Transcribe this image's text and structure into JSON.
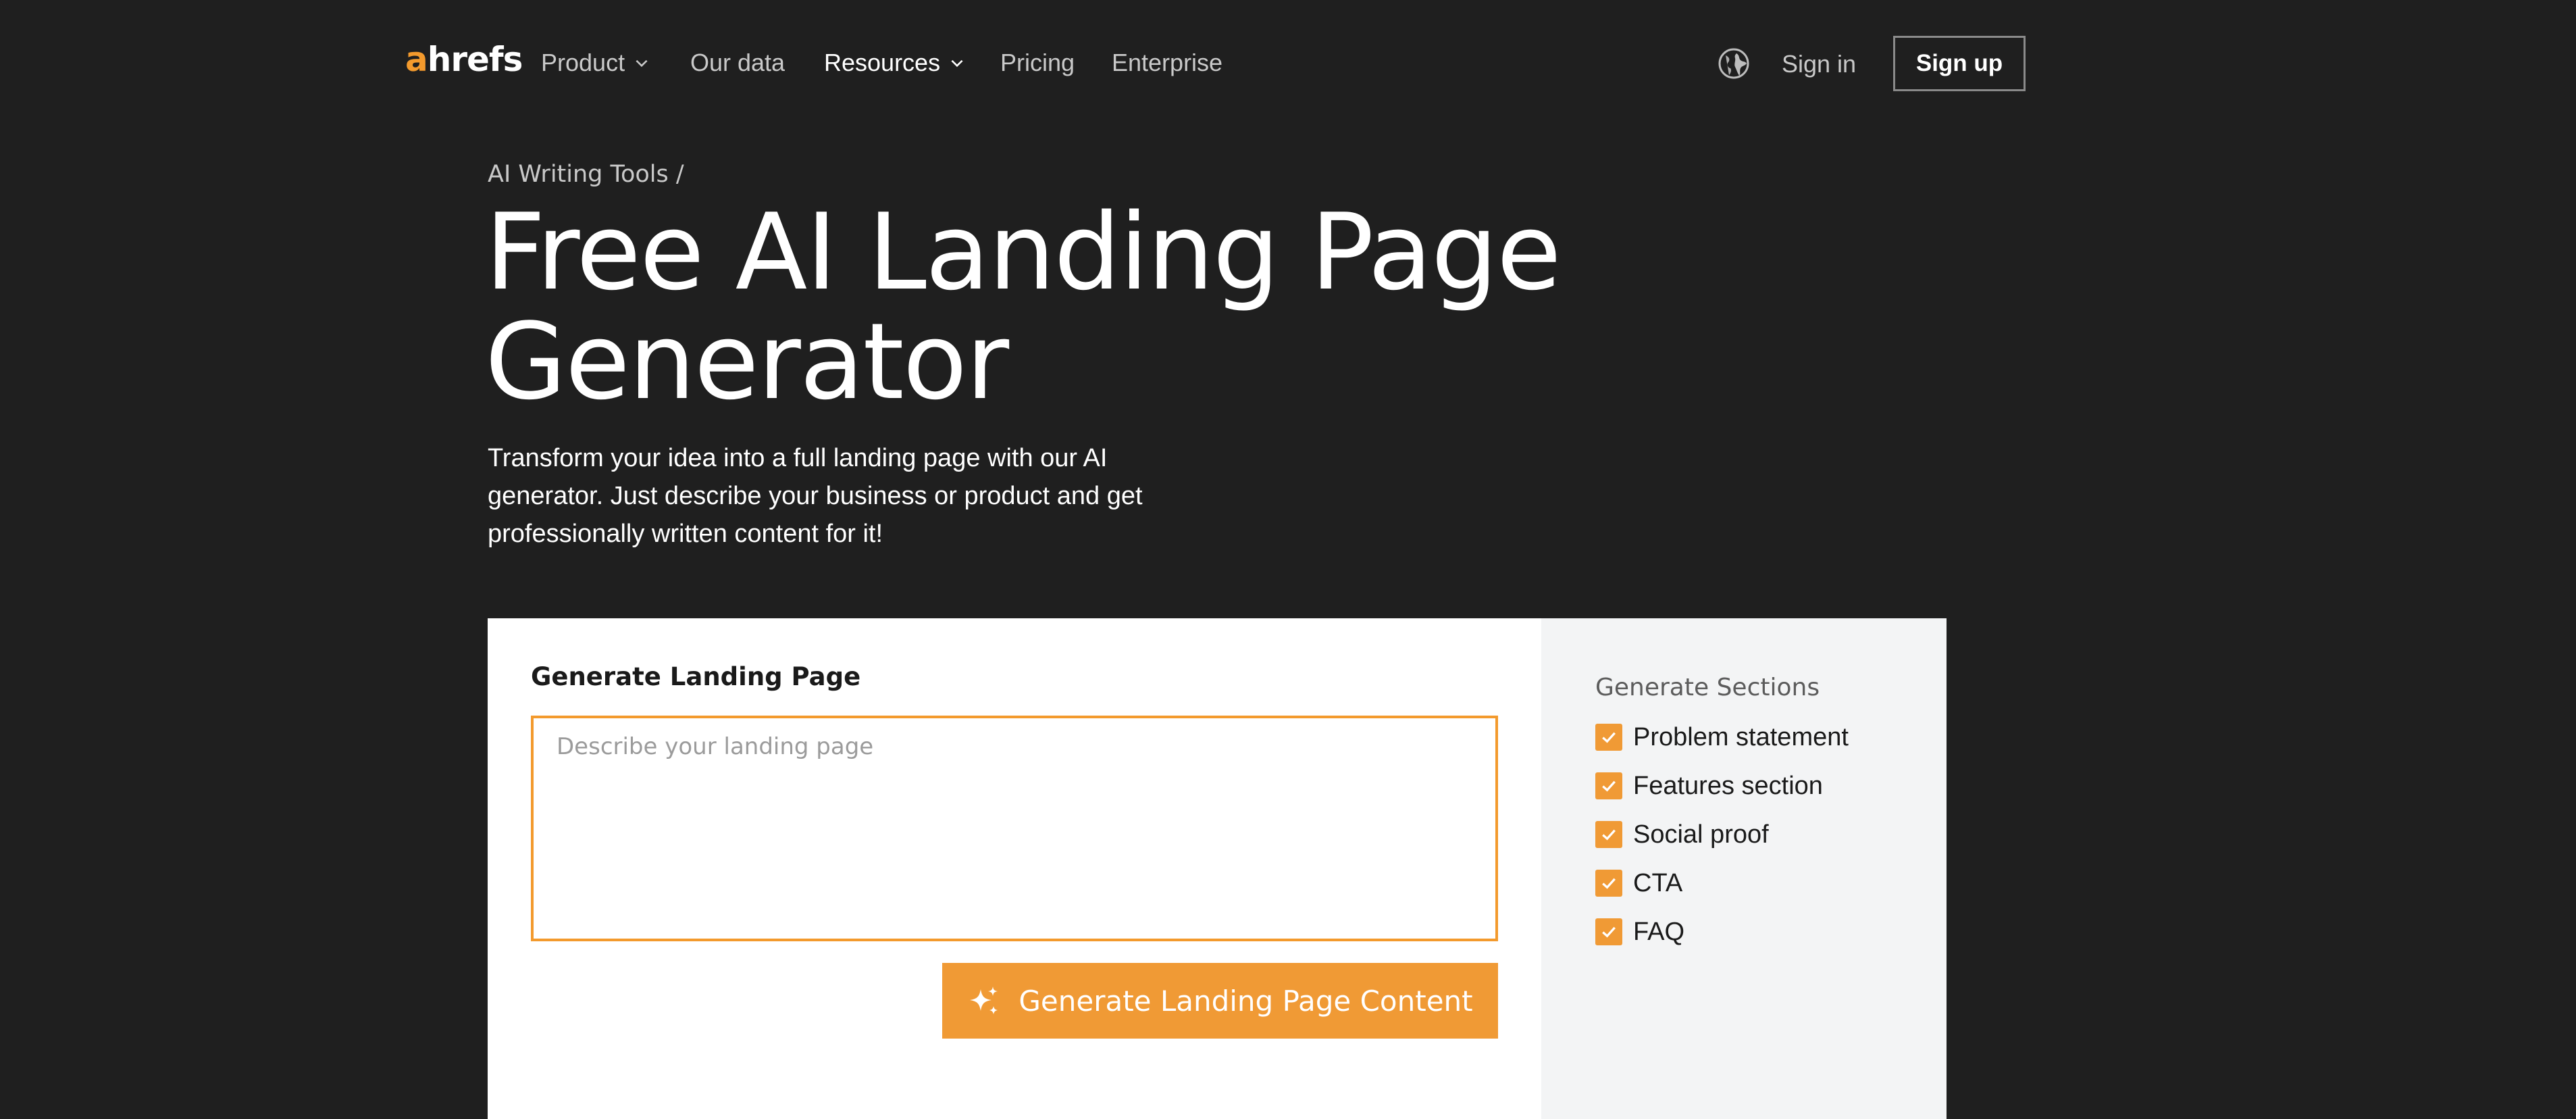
{
  "brand": {
    "logo_a": "a",
    "logo_rest": "hrefs",
    "accent": "#f39a2d"
  },
  "nav": {
    "items": [
      {
        "label": "Product",
        "dropdown": true
      },
      {
        "label": "Our data",
        "dropdown": false
      },
      {
        "label": "Resources",
        "dropdown": true
      },
      {
        "label": "Pricing",
        "dropdown": false
      },
      {
        "label": "Enterprise",
        "dropdown": false
      }
    ],
    "language_icon": "globe-icon",
    "sign_in": "Sign in",
    "sign_up": "Sign up"
  },
  "hero": {
    "breadcrumb": "AI Writing Tools /",
    "title_line1": "Free AI Landing Page",
    "title_line2": "Generator",
    "description": "Transform your idea into a full landing page with our AI generator. Just describe your business or product and get professionally written content for it!"
  },
  "form": {
    "label": "Generate Landing Page",
    "textarea_value": "",
    "placeholder": "Describe your landing page",
    "submit_label": "Generate Landing Page Content",
    "submit_icon": "sparkle-icon",
    "button_color": "#f09a35"
  },
  "sections": {
    "label": "Generate Sections",
    "options": [
      {
        "label": "Problem statement",
        "checked": true
      },
      {
        "label": "Features section",
        "checked": true
      },
      {
        "label": "Social proof",
        "checked": true
      },
      {
        "label": "CTA",
        "checked": true
      },
      {
        "label": "FAQ",
        "checked": true
      }
    ]
  }
}
